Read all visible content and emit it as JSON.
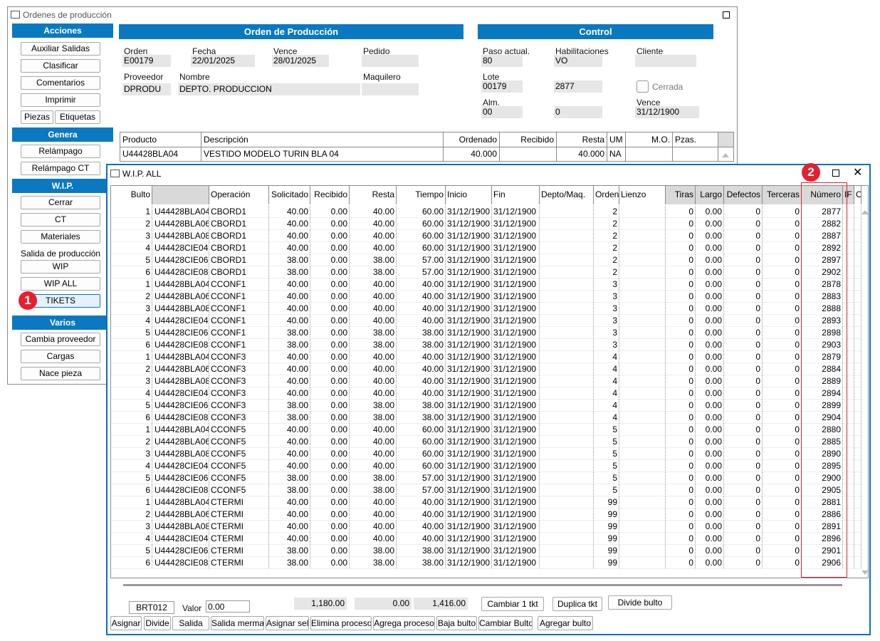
{
  "main_window": {
    "title": "Ordenes de producción",
    "sidebar": {
      "acciones_header": "Acciones",
      "acciones": [
        "Auxiliar Salidas",
        "Clasificar",
        "Comentarios",
        "Imprimir"
      ],
      "piezas": "Piezas",
      "etiquetas": "Etiquetas",
      "genera_header": "Genera",
      "genera": [
        "Relámpago",
        "Relámpago CT"
      ],
      "wip_header": "W.I.P.",
      "wip": [
        "Cerrar",
        "CT",
        "Materiales"
      ],
      "salida_label": "Salida de producción",
      "wip_btn": "WIP",
      "wip_all_btn": "WIP ALL",
      "tikets_btn": "TIKETS",
      "varios_header": "Varios",
      "varios": [
        "Cambia proveedor",
        "Cargas",
        "Nace pieza"
      ]
    },
    "orden": {
      "header": "Orden de Producción",
      "orden_label": "Orden",
      "orden_value": "E00179",
      "fecha_label": "Fecha",
      "fecha_value": "22/01/2025",
      "vence_label": "Vence",
      "vence_value": "28/01/2025",
      "pedido_label": "Pedido",
      "pedido_value": "",
      "proveedor_label": "Proveedor",
      "proveedor_value": "DPRODU",
      "nombre_label": "Nombre",
      "nombre_value": "DEPTO. PRODUCCION",
      "maquilero_label": "Maquilero",
      "maquilero_value": ""
    },
    "control": {
      "header": "Control",
      "paso_label": "Paso actual.",
      "paso_value": "80",
      "habil_label": "Habilitaciones",
      "habil_value": "VO",
      "cliente_label": "Cliente",
      "cliente_value": "",
      "lote_label": "Lote",
      "lote_value": "00179",
      "lote_value2": "2877",
      "cerrada_label": "Cerrada",
      "alm_label": "Alm.",
      "alm_value": "00",
      "alm_value2": "0",
      "vence_label": "Vence",
      "vence_value": "31/12/1900"
    },
    "product_grid": {
      "headers": [
        "Producto",
        "Descripción",
        "Ordenado",
        "Recibido",
        "Resta",
        "UM",
        "M.O.",
        "Pzas."
      ],
      "row": [
        "U44428BLA04",
        "VESTIDO MODELO TURIN BLA 04",
        "40.000",
        "",
        "40.000",
        "NA",
        "",
        ""
      ]
    }
  },
  "wip_window": {
    "title": "W.I.P. ALL",
    "headers": [
      "Bulto",
      "",
      "Operación",
      "Solicitado",
      "Recibido",
      "Resta",
      "Tiempo",
      "Inicio",
      "Fin",
      "Depto/Maq.",
      "Orden",
      "Lienzo",
      "Tiras",
      "Largo",
      "Defectos",
      "Terceras",
      "Número",
      "IF",
      "O"
    ],
    "rows": [
      [
        "1",
        "U44428BLA04",
        "CBORD1",
        "40.00",
        "0.00",
        "40.00",
        "60.00",
        "31/12/1900",
        "31/12/1900",
        "",
        "2",
        "",
        "0",
        "0.00",
        "0",
        "0",
        "2877"
      ],
      [
        "2",
        "U44428BLA06",
        "CBORD1",
        "40.00",
        "0.00",
        "40.00",
        "60.00",
        "31/12/1900",
        "31/12/1900",
        "",
        "2",
        "",
        "0",
        "0.00",
        "0",
        "0",
        "2882"
      ],
      [
        "3",
        "U44428BLA08",
        "CBORD1",
        "40.00",
        "0.00",
        "40.00",
        "60.00",
        "31/12/1900",
        "31/12/1900",
        "",
        "2",
        "",
        "0",
        "0.00",
        "0",
        "0",
        "2887"
      ],
      [
        "4",
        "U44428CIE04",
        "CBORD1",
        "40.00",
        "0.00",
        "40.00",
        "60.00",
        "31/12/1900",
        "31/12/1900",
        "",
        "2",
        "",
        "0",
        "0.00",
        "0",
        "0",
        "2892"
      ],
      [
        "5",
        "U44428CIE06",
        "CBORD1",
        "38.00",
        "0.00",
        "38.00",
        "57.00",
        "31/12/1900",
        "31/12/1900",
        "",
        "2",
        "",
        "0",
        "0.00",
        "0",
        "0",
        "2897"
      ],
      [
        "6",
        "U44428CIE08",
        "CBORD1",
        "38.00",
        "0.00",
        "38.00",
        "57.00",
        "31/12/1900",
        "31/12/1900",
        "",
        "2",
        "",
        "0",
        "0.00",
        "0",
        "0",
        "2902"
      ],
      [
        "1",
        "U44428BLA04",
        "CCONF1",
        "40.00",
        "0.00",
        "40.00",
        "40.00",
        "31/12/1900",
        "31/12/1900",
        "",
        "3",
        "",
        "0",
        "0.00",
        "0",
        "0",
        "2878"
      ],
      [
        "2",
        "U44428BLA06",
        "CCONF1",
        "40.00",
        "0.00",
        "40.00",
        "40.00",
        "31/12/1900",
        "31/12/1900",
        "",
        "3",
        "",
        "0",
        "0.00",
        "0",
        "0",
        "2883"
      ],
      [
        "3",
        "U44428BLA08",
        "CCONF1",
        "40.00",
        "0.00",
        "40.00",
        "40.00",
        "31/12/1900",
        "31/12/1900",
        "",
        "3",
        "",
        "0",
        "0.00",
        "0",
        "0",
        "2888"
      ],
      [
        "4",
        "U44428CIE04",
        "CCONF1",
        "40.00",
        "0.00",
        "40.00",
        "40.00",
        "31/12/1900",
        "31/12/1900",
        "",
        "3",
        "",
        "0",
        "0.00",
        "0",
        "0",
        "2893"
      ],
      [
        "5",
        "U44428CIE06",
        "CCONF1",
        "38.00",
        "0.00",
        "38.00",
        "38.00",
        "31/12/1900",
        "31/12/1900",
        "",
        "3",
        "",
        "0",
        "0.00",
        "0",
        "0",
        "2898"
      ],
      [
        "6",
        "U44428CIE08",
        "CCONF1",
        "38.00",
        "0.00",
        "38.00",
        "38.00",
        "31/12/1900",
        "31/12/1900",
        "",
        "3",
        "",
        "0",
        "0.00",
        "0",
        "0",
        "2903"
      ],
      [
        "1",
        "U44428BLA04",
        "CCONF3",
        "40.00",
        "0.00",
        "40.00",
        "40.00",
        "31/12/1900",
        "31/12/1900",
        "",
        "4",
        "",
        "0",
        "0.00",
        "0",
        "0",
        "2879"
      ],
      [
        "2",
        "U44428BLA06",
        "CCONF3",
        "40.00",
        "0.00",
        "40.00",
        "40.00",
        "31/12/1900",
        "31/12/1900",
        "",
        "4",
        "",
        "0",
        "0.00",
        "0",
        "0",
        "2884"
      ],
      [
        "3",
        "U44428BLA08",
        "CCONF3",
        "40.00",
        "0.00",
        "40.00",
        "40.00",
        "31/12/1900",
        "31/12/1900",
        "",
        "4",
        "",
        "0",
        "0.00",
        "0",
        "0",
        "2889"
      ],
      [
        "4",
        "U44428CIE04",
        "CCONF3",
        "40.00",
        "0.00",
        "40.00",
        "40.00",
        "31/12/1900",
        "31/12/1900",
        "",
        "4",
        "",
        "0",
        "0.00",
        "0",
        "0",
        "2894"
      ],
      [
        "5",
        "U44428CIE06",
        "CCONF3",
        "38.00",
        "0.00",
        "38.00",
        "38.00",
        "31/12/1900",
        "31/12/1900",
        "",
        "4",
        "",
        "0",
        "0.00",
        "0",
        "0",
        "2899"
      ],
      [
        "6",
        "U44428CIE08",
        "CCONF3",
        "38.00",
        "0.00",
        "38.00",
        "38.00",
        "31/12/1900",
        "31/12/1900",
        "",
        "4",
        "",
        "0",
        "0.00",
        "0",
        "0",
        "2904"
      ],
      [
        "1",
        "U44428BLA04",
        "CCONF5",
        "40.00",
        "0.00",
        "40.00",
        "60.00",
        "31/12/1900",
        "31/12/1900",
        "",
        "5",
        "",
        "0",
        "0.00",
        "0",
        "0",
        "2880"
      ],
      [
        "2",
        "U44428BLA06",
        "CCONF5",
        "40.00",
        "0.00",
        "40.00",
        "60.00",
        "31/12/1900",
        "31/12/1900",
        "",
        "5",
        "",
        "0",
        "0.00",
        "0",
        "0",
        "2885"
      ],
      [
        "3",
        "U44428BLA08",
        "CCONF5",
        "40.00",
        "0.00",
        "40.00",
        "60.00",
        "31/12/1900",
        "31/12/1900",
        "",
        "5",
        "",
        "0",
        "0.00",
        "0",
        "0",
        "2890"
      ],
      [
        "4",
        "U44428CIE04",
        "CCONF5",
        "40.00",
        "0.00",
        "40.00",
        "60.00",
        "31/12/1900",
        "31/12/1900",
        "",
        "5",
        "",
        "0",
        "0.00",
        "0",
        "0",
        "2895"
      ],
      [
        "5",
        "U44428CIE06",
        "CCONF5",
        "38.00",
        "0.00",
        "38.00",
        "57.00",
        "31/12/1900",
        "31/12/1900",
        "",
        "5",
        "",
        "0",
        "0.00",
        "0",
        "0",
        "2900"
      ],
      [
        "6",
        "U44428CIE08",
        "CCONF5",
        "38.00",
        "0.00",
        "38.00",
        "57.00",
        "31/12/1900",
        "31/12/1900",
        "",
        "5",
        "",
        "0",
        "0.00",
        "0",
        "0",
        "2905"
      ],
      [
        "1",
        "U44428BLA04",
        "CTERMI",
        "40.00",
        "0.00",
        "40.00",
        "40.00",
        "31/12/1900",
        "31/12/1900",
        "",
        "99",
        "",
        "0",
        "0.00",
        "0",
        "0",
        "2881"
      ],
      [
        "2",
        "U44428BLA06",
        "CTERMI",
        "40.00",
        "0.00",
        "40.00",
        "40.00",
        "31/12/1900",
        "31/12/1900",
        "",
        "99",
        "",
        "0",
        "0.00",
        "0",
        "0",
        "2886"
      ],
      [
        "3",
        "U44428BLA08",
        "CTERMI",
        "40.00",
        "0.00",
        "40.00",
        "40.00",
        "31/12/1900",
        "31/12/1900",
        "",
        "99",
        "",
        "0",
        "0.00",
        "0",
        "0",
        "2891"
      ],
      [
        "4",
        "U44428CIE04",
        "CTERMI",
        "40.00",
        "0.00",
        "40.00",
        "40.00",
        "31/12/1900",
        "31/12/1900",
        "",
        "99",
        "",
        "0",
        "0.00",
        "0",
        "0",
        "2896"
      ],
      [
        "5",
        "U44428CIE06",
        "CTERMI",
        "38.00",
        "0.00",
        "38.00",
        "38.00",
        "31/12/1900",
        "31/12/1900",
        "",
        "99",
        "",
        "0",
        "0.00",
        "0",
        "0",
        "2901"
      ],
      [
        "6",
        "U44428CIE08",
        "CTERMI",
        "38.00",
        "0.00",
        "38.00",
        "38.00",
        "31/12/1900",
        "31/12/1900",
        "",
        "99",
        "",
        "0",
        "0.00",
        "0",
        "0",
        "2906"
      ]
    ],
    "footer": {
      "brt": "BRT012",
      "valor_label": "Valor",
      "valor_value": "0.00",
      "total1": "1,180.00",
      "total2": "0.00",
      "total3": "1,416.00",
      "cambiar_1_tkt": "Cambiar 1 tkt",
      "duplica_tkt": "Duplica tkt",
      "divide_bulto": "Divide bulto",
      "buttons": [
        "Asignar",
        "Divide",
        "Salida",
        "Salida merma",
        "Asignar sel",
        "Elimina proceso",
        "Agrega proceso",
        "Baja bulto",
        "Cambiar Bulto",
        "Agregar bulto"
      ]
    }
  },
  "annotations": {
    "badge1": "1",
    "badge2": "2"
  },
  "colors": {
    "accent": "#0a79c2",
    "badge": "#e4202f"
  }
}
